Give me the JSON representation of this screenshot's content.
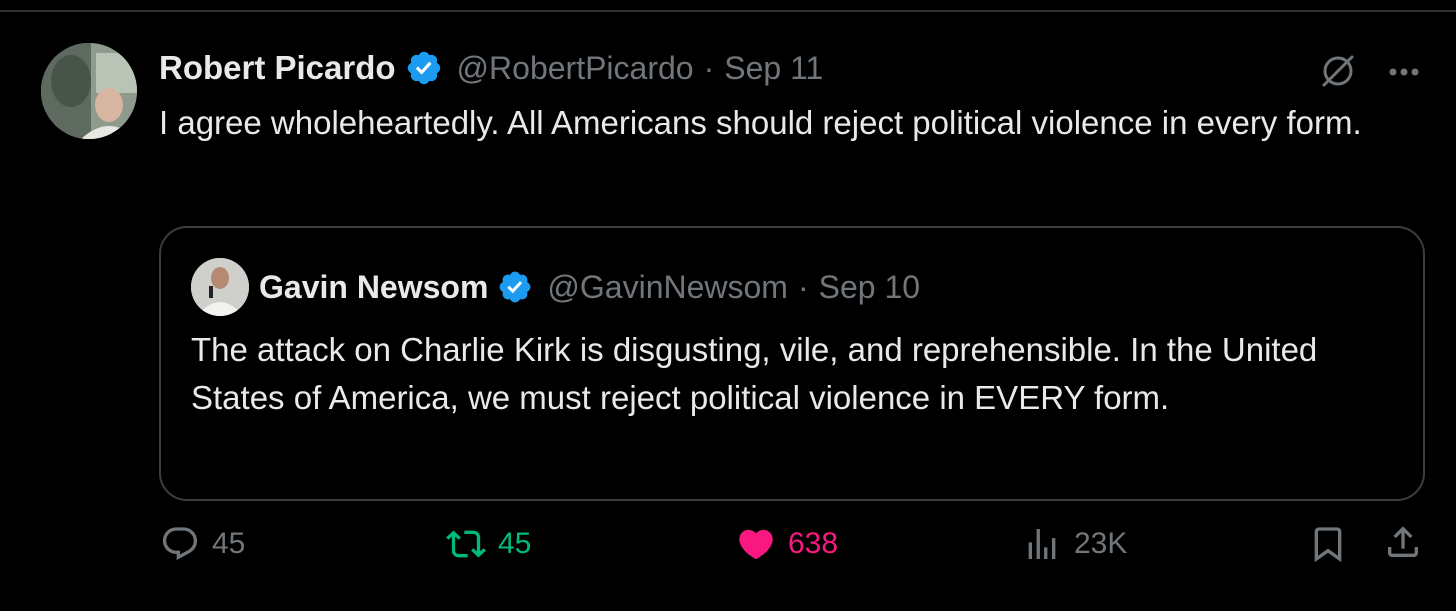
{
  "tweet": {
    "display_name": "Robert Picardo",
    "handle": "@RobertPicardo",
    "separator": "·",
    "date": "Sep 11",
    "text": "I agree wholeheartedly. All Americans should reject political violence in every form.",
    "verified_icon": "verified-badge-icon",
    "menu_icons": [
      "grok-icon",
      "more-icon"
    ]
  },
  "quote": {
    "display_name": "Gavin Newsom",
    "handle": "@GavinNewsom",
    "separator": "·",
    "date": "Sep 10",
    "text": "The attack on Charlie Kirk is disgusting, vile, and reprehensible. In the United States of America, we must reject political violence in EVERY form."
  },
  "actions": {
    "replies": "45",
    "reposts": "45",
    "likes": "638",
    "views": "23K"
  },
  "colors": {
    "background": "#000000",
    "text_primary": "#e7e9ea",
    "text_secondary": "#71767b",
    "verified": "#1d9bf0",
    "repost_active": "#00ba7c",
    "like_active": "#f91880",
    "border": "#2f3336"
  }
}
